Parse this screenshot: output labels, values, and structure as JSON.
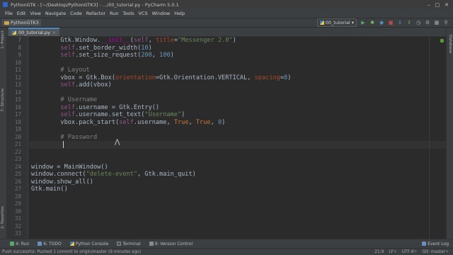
{
  "window": {
    "title": "PythonGTK - [~/Desktop/PythonGTK3] - .../00_tutorial.py - PyCharm 5.0.1",
    "controls": [
      "–",
      "□",
      "✕"
    ]
  },
  "menu": [
    "File",
    "Edit",
    "View",
    "Navigate",
    "Code",
    "Refactor",
    "Run",
    "Tools",
    "VCS",
    "Window",
    "Help"
  ],
  "navbar": {
    "project": "PythonGTK3",
    "run_config": "00_tutorial",
    "buttons": [
      "run-icon",
      "debug-icon",
      "coverage-icon",
      "stop-icon",
      "vcs-update-icon",
      "vcs-commit-icon",
      "history-icon",
      "settings-icon",
      "structure-icon",
      "search-icon"
    ]
  },
  "tabs": [
    {
      "label": "00_tutorial.py",
      "close": "×"
    }
  ],
  "left_tool_tabs": {
    "project": "1: Project",
    "structure": "7: Structure",
    "favorites": "2: Favorites"
  },
  "right_tool_tabs": {
    "database": "Database"
  },
  "editor": {
    "current_line": "21",
    "lines": [
      {
        "no": "7",
        "segs": [
          {
            "c": "",
            "t": "        Gtk.Window."
          },
          {
            "c": "dun",
            "t": "__init__"
          },
          {
            "c": "",
            "t": "("
          },
          {
            "c": "slf",
            "t": "self"
          },
          {
            "c": "",
            "t": ", "
          },
          {
            "c": "prm",
            "t": "title"
          },
          {
            "c": "",
            "t": "="
          },
          {
            "c": "str",
            "t": "\"Messenger 2.0\""
          },
          {
            "c": "",
            "t": ")"
          }
        ]
      },
      {
        "no": "8",
        "segs": [
          {
            "c": "",
            "t": "        "
          },
          {
            "c": "slf",
            "t": "self"
          },
          {
            "c": "",
            "t": ".set_border_width("
          },
          {
            "c": "num",
            "t": "10"
          },
          {
            "c": "",
            "t": ")"
          }
        ]
      },
      {
        "no": "9",
        "segs": [
          {
            "c": "",
            "t": "        "
          },
          {
            "c": "slf",
            "t": "self"
          },
          {
            "c": "",
            "t": ".set_size_request("
          },
          {
            "c": "num",
            "t": "200"
          },
          {
            "c": "",
            "t": ", "
          },
          {
            "c": "num",
            "t": "100"
          },
          {
            "c": "",
            "t": ")"
          }
        ]
      },
      {
        "no": "10",
        "segs": [
          {
            "c": "",
            "t": ""
          }
        ]
      },
      {
        "no": "11",
        "segs": [
          {
            "c": "cmt",
            "t": "        # Layout"
          }
        ]
      },
      {
        "no": "12",
        "segs": [
          {
            "c": "",
            "t": "        vbox = Gtk.Box("
          },
          {
            "c": "prm",
            "t": "orientation"
          },
          {
            "c": "",
            "t": "=Gtk.Orientation.VERTICAL, "
          },
          {
            "c": "prm",
            "t": "spacing"
          },
          {
            "c": "",
            "t": "="
          },
          {
            "c": "num",
            "t": "8"
          },
          {
            "c": "",
            "t": ")"
          }
        ]
      },
      {
        "no": "13",
        "segs": [
          {
            "c": "",
            "t": "        "
          },
          {
            "c": "slf",
            "t": "self"
          },
          {
            "c": "",
            "t": ".add(vbox)"
          }
        ]
      },
      {
        "no": "14",
        "segs": [
          {
            "c": "",
            "t": ""
          }
        ]
      },
      {
        "no": "15",
        "segs": [
          {
            "c": "cmt",
            "t": "        # Username"
          }
        ]
      },
      {
        "no": "16",
        "segs": [
          {
            "c": "",
            "t": "        "
          },
          {
            "c": "slf",
            "t": "self"
          },
          {
            "c": "",
            "t": ".username = Gtk.Entry()"
          }
        ]
      },
      {
        "no": "17",
        "segs": [
          {
            "c": "",
            "t": "        "
          },
          {
            "c": "slf",
            "t": "self"
          },
          {
            "c": "",
            "t": ".username.set_text("
          },
          {
            "c": "str",
            "t": "\"Username\""
          },
          {
            "c": "",
            "t": ")"
          }
        ]
      },
      {
        "no": "18",
        "segs": [
          {
            "c": "",
            "t": "        vbox.pack_start("
          },
          {
            "c": "slf",
            "t": "self"
          },
          {
            "c": "",
            "t": ".username, "
          },
          {
            "c": "kw",
            "t": "True"
          },
          {
            "c": "",
            "t": ", "
          },
          {
            "c": "kw",
            "t": "True"
          },
          {
            "c": "",
            "t": ", "
          },
          {
            "c": "num",
            "t": "0"
          },
          {
            "c": "",
            "t": ")"
          }
        ]
      },
      {
        "no": "19",
        "segs": [
          {
            "c": "",
            "t": ""
          }
        ]
      },
      {
        "no": "20",
        "segs": [
          {
            "c": "cmt",
            "t": "        # Password"
          }
        ]
      },
      {
        "no": "21",
        "segs": [
          {
            "c": "",
            "t": "        "
          }
        ]
      },
      {
        "no": "22",
        "segs": [
          {
            "c": "",
            "t": ""
          }
        ]
      },
      {
        "no": "23",
        "segs": [
          {
            "c": "",
            "t": ""
          }
        ]
      },
      {
        "no": "24",
        "segs": [
          {
            "c": "",
            "t": "window = MainWindow()"
          }
        ]
      },
      {
        "no": "25",
        "segs": [
          {
            "c": "",
            "t": "window.connect("
          },
          {
            "c": "str",
            "t": "\"delete-event\""
          },
          {
            "c": "",
            "t": ", Gtk.main_quit)"
          }
        ]
      },
      {
        "no": "26",
        "segs": [
          {
            "c": "",
            "t": "window.show_all()"
          }
        ]
      },
      {
        "no": "27",
        "segs": [
          {
            "c": "",
            "t": "Gtk.main()"
          }
        ]
      },
      {
        "no": "28",
        "segs": [
          {
            "c": "",
            "t": ""
          }
        ]
      },
      {
        "no": "29",
        "segs": [
          {
            "c": "",
            "t": ""
          }
        ]
      },
      {
        "no": "30",
        "segs": [
          {
            "c": "",
            "t": ""
          }
        ]
      },
      {
        "no": "31",
        "segs": [
          {
            "c": "",
            "t": ""
          }
        ]
      },
      {
        "no": "32",
        "segs": [
          {
            "c": "",
            "t": ""
          }
        ]
      },
      {
        "no": "33",
        "segs": [
          {
            "c": "",
            "t": ""
          }
        ]
      },
      {
        "no": "34",
        "segs": [
          {
            "c": "",
            "t": ""
          }
        ]
      }
    ]
  },
  "tool_windows": {
    "run": "4: Run",
    "todo": "6: TODO",
    "python_console": "Python Console",
    "terminal": "Terminal",
    "vcs": "9: Version Control",
    "event_log": "Event Log"
  },
  "status": {
    "message": "Push successful: Pushed 1 commit to origin/master (9 minutes ago)",
    "position": "21:9",
    "line_sep": "LF÷",
    "encoding": "UTF-8÷",
    "vcs_branch": "Git: master÷"
  },
  "colors": {
    "editor_bg": "#2b2b2b",
    "keyword": "#cc7832",
    "self": "#94558d",
    "string": "#6a8759",
    "number": "#6897bb",
    "comment": "#808080",
    "accent": "#4a88c7"
  }
}
